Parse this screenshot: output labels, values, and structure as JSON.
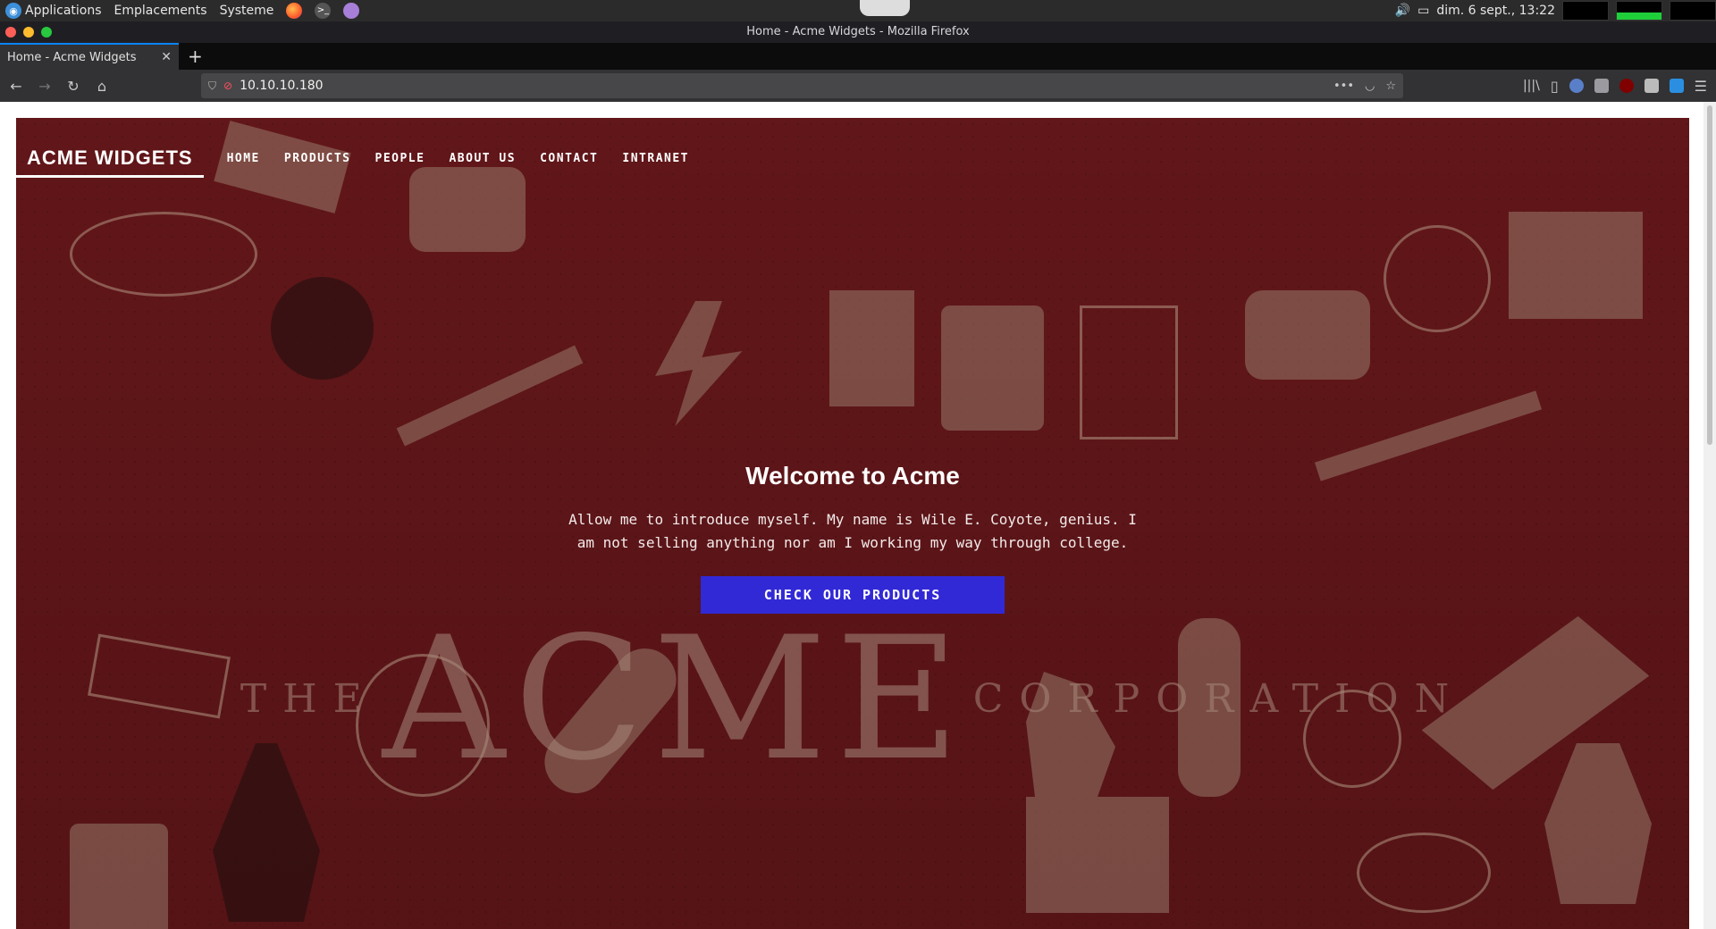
{
  "desktop": {
    "menu": [
      "Applications",
      "Emplacements",
      "Systeme"
    ],
    "clock": "dim. 6 sept., 13:22"
  },
  "browser": {
    "window_title": "Home - Acme Widgets - Mozilla Firefox",
    "tab_title": "Home - Acme Widgets",
    "url": "10.10.10.180"
  },
  "site": {
    "brand": "ACME WIDGETS",
    "nav": [
      "HOME",
      "PRODUCTS",
      "PEOPLE",
      "ABOUT US",
      "CONTACT",
      "INTRANET"
    ],
    "hero": {
      "title": "Welcome to Acme",
      "text": "Allow me to introduce myself. My name is Wile E. Coyote, genius. I am not selling anything nor am I working my way through college.",
      "cta": "CHECK OUR PRODUCTS"
    },
    "background_lettering": {
      "left": "THE",
      "center": "ACME",
      "right": "CORPORATION"
    },
    "colors": {
      "hero_bg": "#6e1b1e",
      "cta_bg": "#3229d6"
    }
  }
}
